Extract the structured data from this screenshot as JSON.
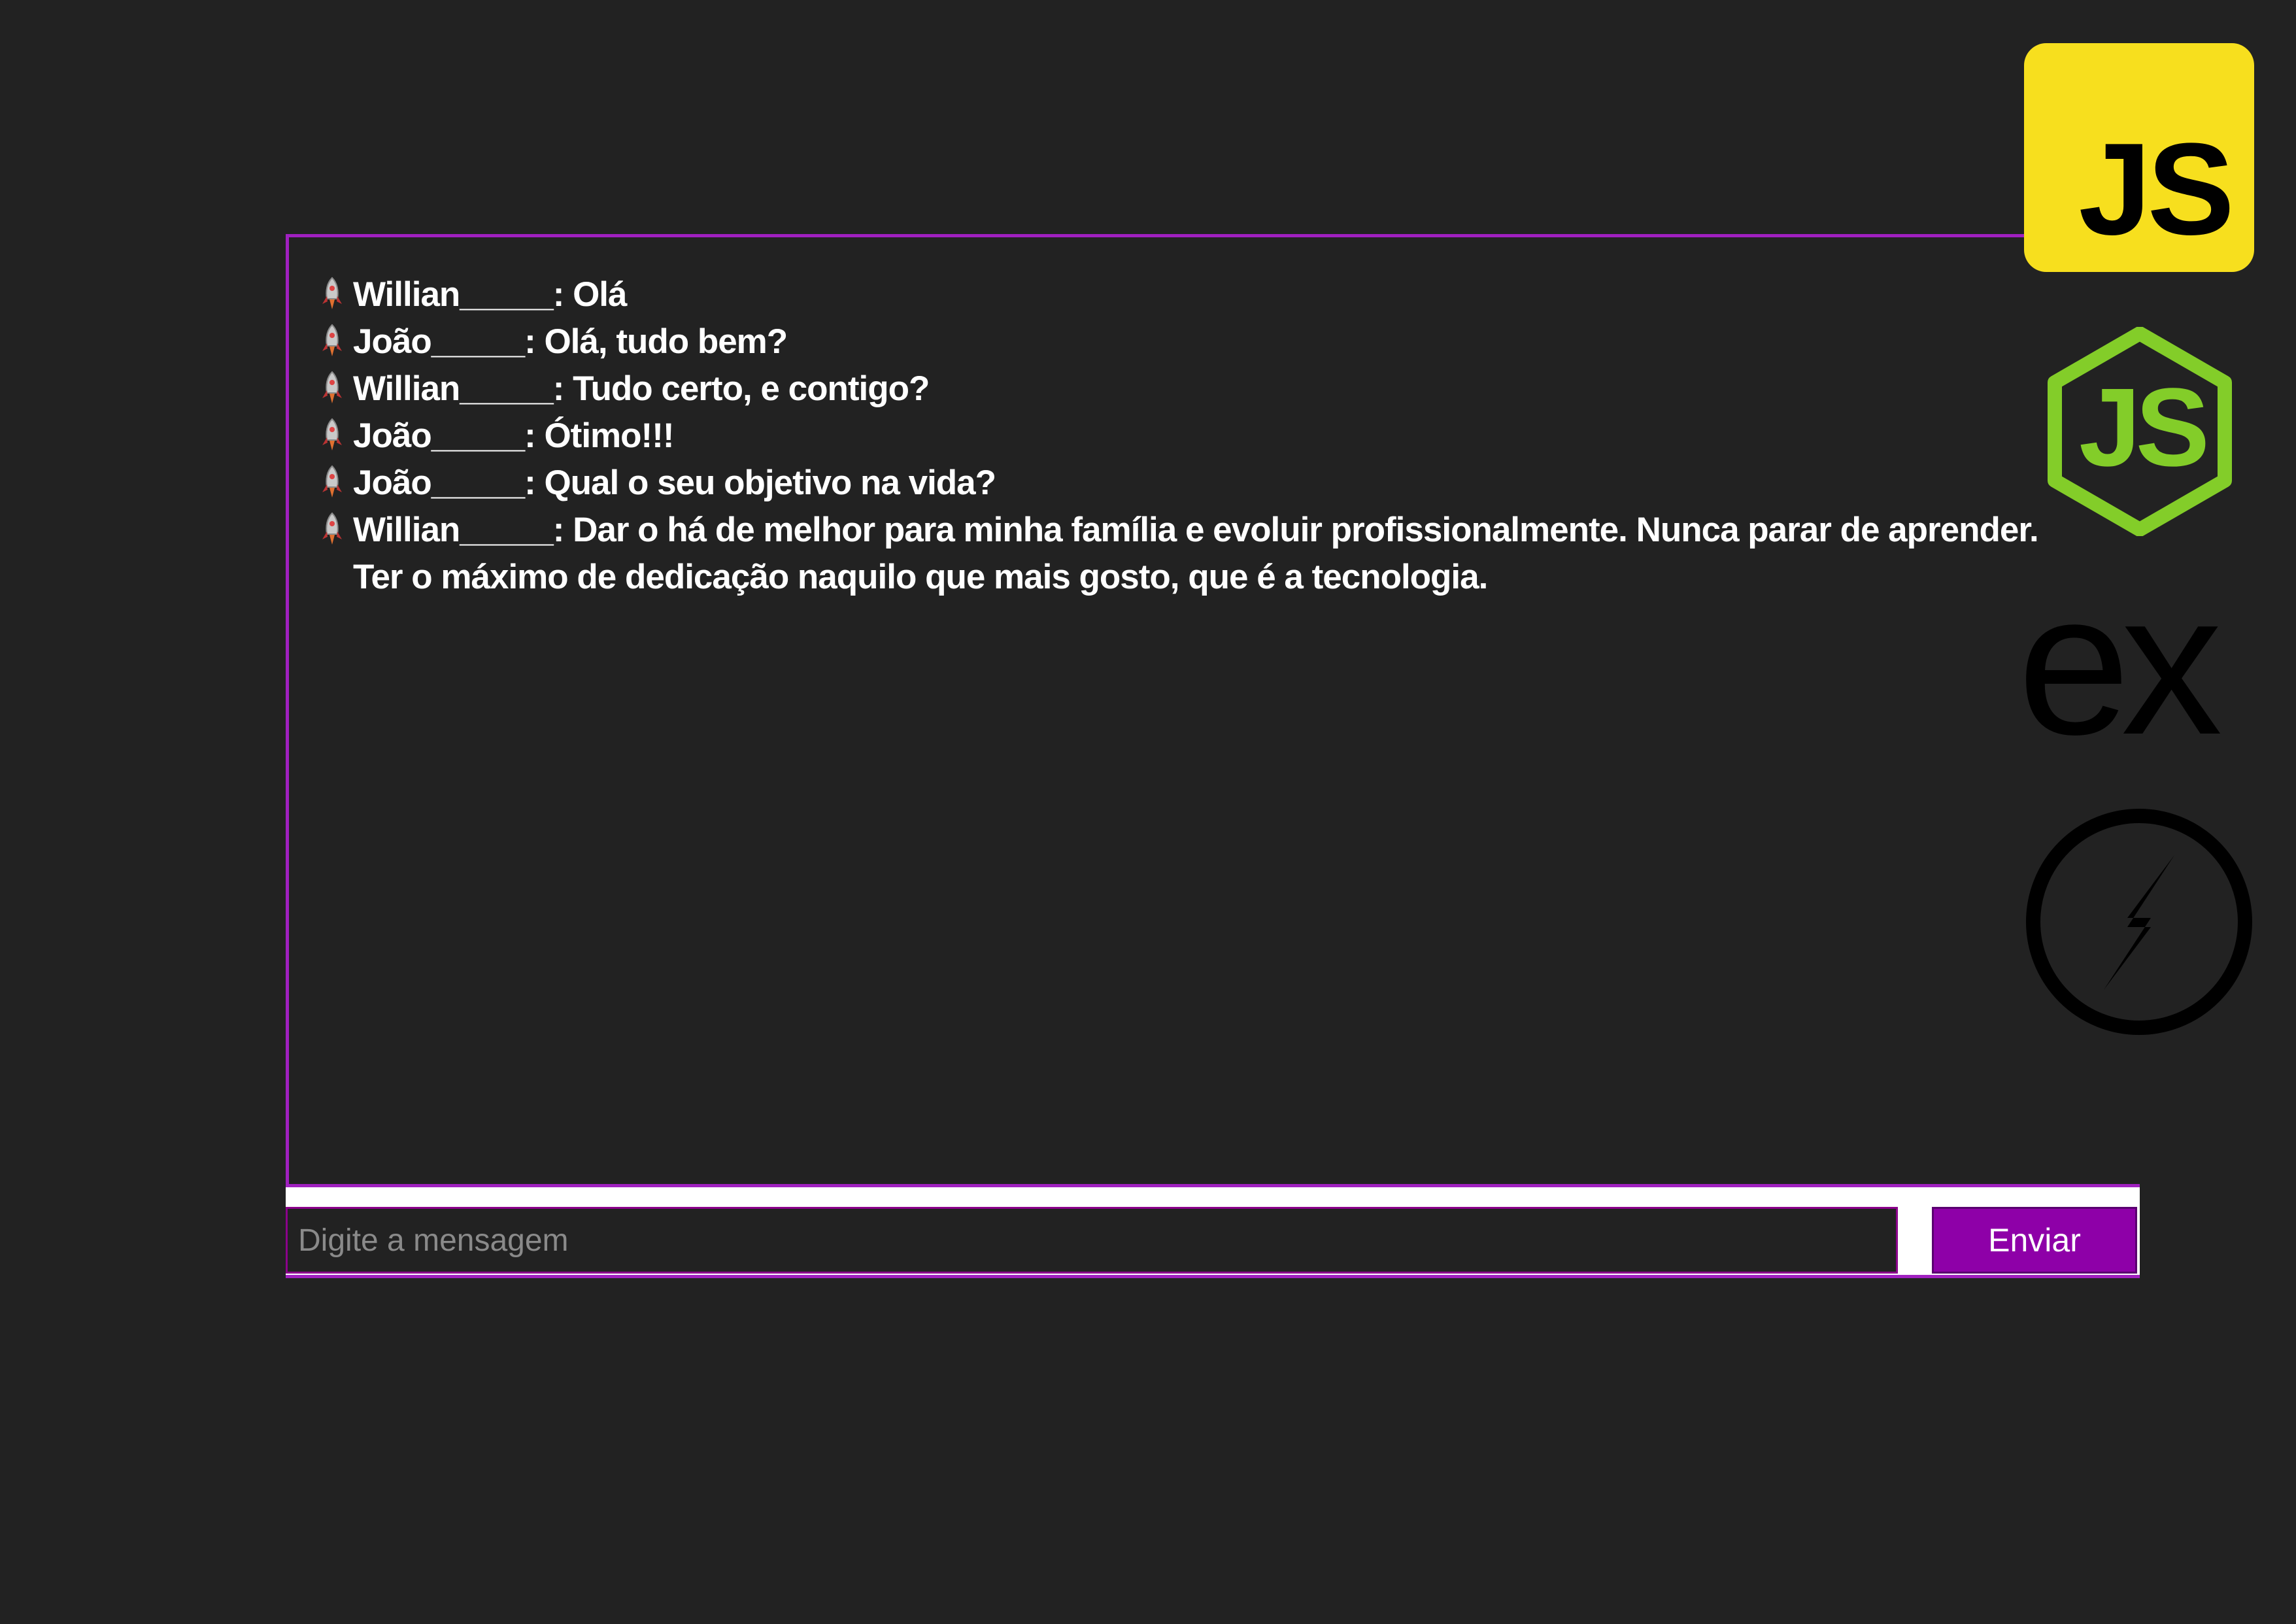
{
  "chat": {
    "messages": [
      {
        "text": "Willian_____: Olá"
      },
      {
        "text": "João_____: Olá, tudo bem?"
      },
      {
        "text": "Willian_____: Tudo certo, e contigo?"
      },
      {
        "text": "João_____: Ótimo!!!"
      },
      {
        "text": "João_____: Qual o seu objetivo na vida?"
      },
      {
        "text": "Willian_____: Dar o há de melhor para minha família e evoluir profissionalmente. Nunca parar de aprender. Ter o máximo de dedicação naquilo que mais gosto, que é a tecnologia."
      }
    ],
    "message_icon": "rocket-icon"
  },
  "composer": {
    "placeholder": "Digite a mensagem",
    "value": "",
    "send_label": "Enviar"
  },
  "logos": {
    "javascript": {
      "text": "JS",
      "icon": "javascript-logo"
    },
    "nodejs": {
      "text": "JS",
      "icon": "nodejs-logo"
    },
    "express": {
      "text": "ex",
      "icon": "express-logo"
    },
    "socketio": {
      "icon": "socketio-logo"
    }
  },
  "colors": {
    "background": "#222222",
    "accent": "#a020c0",
    "button": "#8e00a8",
    "js_yellow": "#f7df1e",
    "node_green": "#83cd29"
  }
}
